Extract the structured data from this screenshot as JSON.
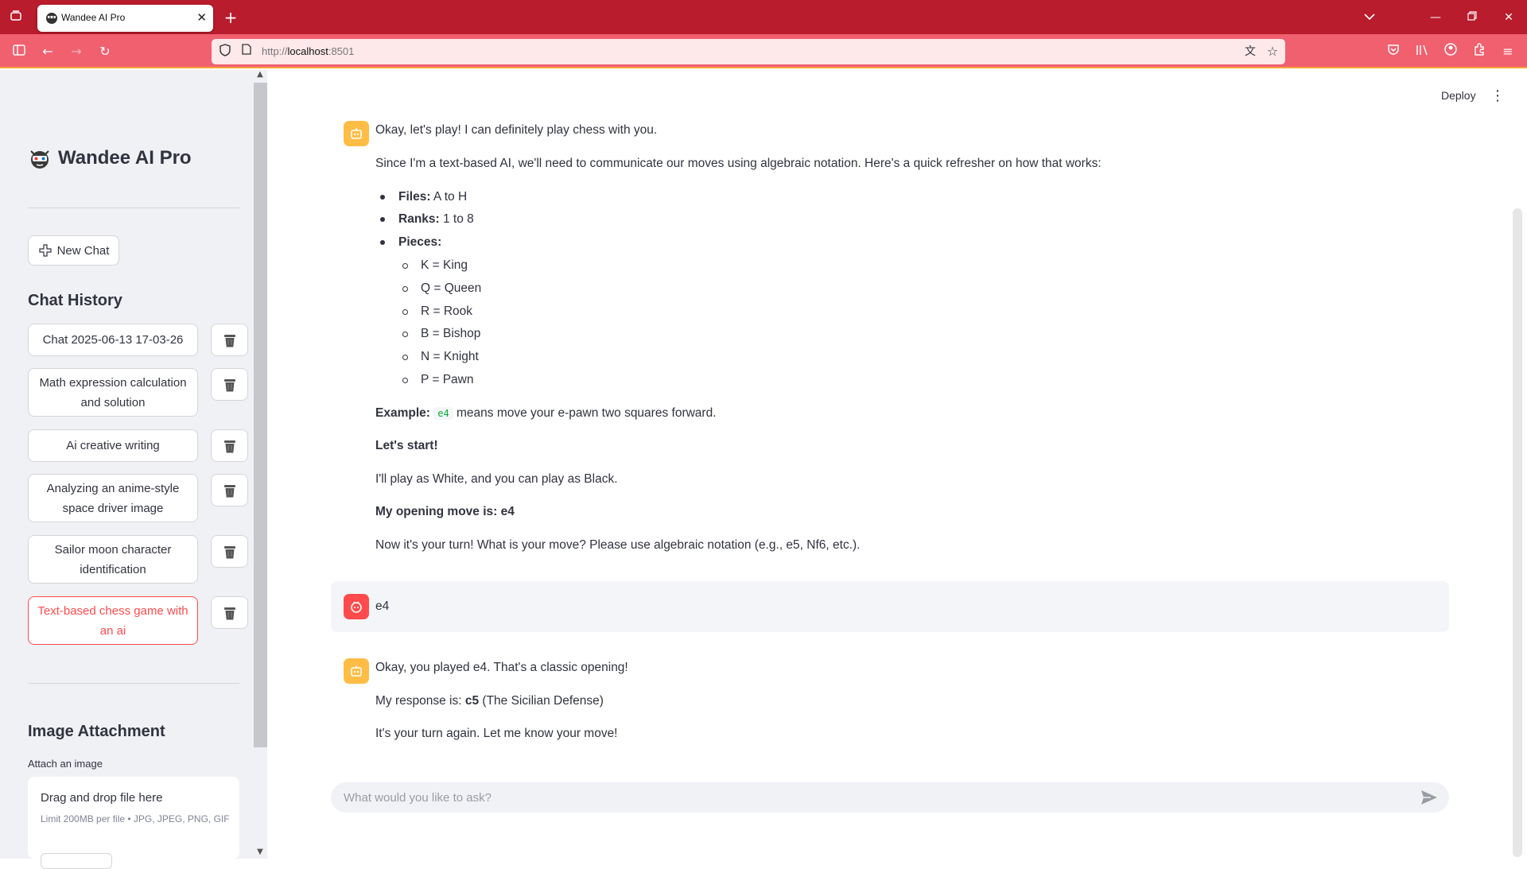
{
  "browser": {
    "tab_title": "Wandee AI Pro",
    "url_prefix": "http://",
    "url_host": "localhost",
    "url_port": ":8501"
  },
  "sidebar": {
    "brand_title": "Wandee AI Pro",
    "new_chat_label": "New Chat",
    "history_title": "Chat History",
    "history": [
      {
        "label": "Chat 2025-06-13 17-03-26",
        "active": false
      },
      {
        "label": "Math expression calculation and solution",
        "active": false
      },
      {
        "label": "Ai creative writing",
        "active": false
      },
      {
        "label": "Analyzing an anime-style space driver image",
        "active": false
      },
      {
        "label": "Sailor moon character identification",
        "active": false
      },
      {
        "label": "Text-based chess game with an ai",
        "active": true
      }
    ],
    "attachment_title": "Image Attachment",
    "attach_label": "Attach an image",
    "drop_title": "Drag and drop file here",
    "drop_sub": "Limit 200MB per file • JPG, JPEG, PNG, GIF"
  },
  "header": {
    "deploy_label": "Deploy"
  },
  "messages": {
    "m1": {
      "intro": "Okay, let's play! I can definitely play chess with you.",
      "p1": "Since I'm a text-based AI, we'll need to communicate our moves using algebraic notation. Here's a quick refresher on how that works:",
      "files_label": "Files:",
      "files_value": " A to H",
      "ranks_label": "Ranks:",
      "ranks_value": " 1 to 8",
      "pieces_label": "Pieces:",
      "pieces": [
        "K = King",
        "Q = Queen",
        "R = Rook",
        "B = Bishop",
        "N = Knight",
        "P = Pawn"
      ],
      "example_label": "Example:",
      "example_code": "e4",
      "example_text": "means move your e-pawn two squares forward.",
      "lets_start": "Let's start!",
      "play_as": "I'll play as White, and you can play as Black.",
      "opening": "My opening move is: e4",
      "your_turn": "Now it's your turn! What is your move? Please use algebraic notation (e.g., e5, Nf6, etc.)."
    },
    "m2": {
      "text": "e4"
    },
    "m3": {
      "line1": "Okay, you played e4. That's a classic opening!",
      "response_prefix": "My response is: ",
      "response_move": "c5",
      "response_suffix": " (The Sicilian Defense)",
      "line3": "It's your turn again. Let me know your move!"
    }
  },
  "chat_input": {
    "placeholder": "What would you like to ask?"
  },
  "colors": {
    "accent": "#ff4b4b",
    "bot_avatar": "#ffbd45",
    "browser_bar": "#b91c2c",
    "nav_bar": "#f0606f"
  }
}
